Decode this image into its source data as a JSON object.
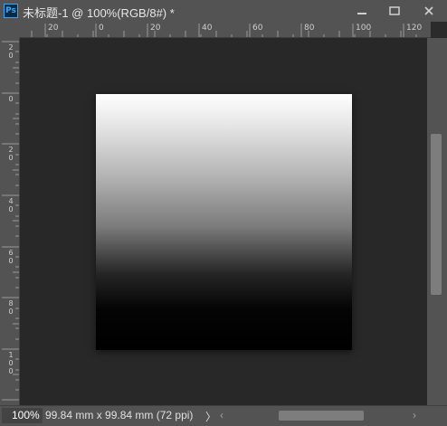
{
  "window": {
    "app_icon": "ps-app-icon",
    "app_icon_label": "Ps",
    "title": "未标题-1 @ 100%(RGB/8#) *"
  },
  "ruler_top": {
    "labels": [
      "20",
      "0",
      "20",
      "40",
      "60",
      "80",
      "100",
      "120"
    ]
  },
  "ruler_left": {
    "labels": [
      [
        "2",
        "0"
      ],
      [
        "0"
      ],
      [
        "2",
        "0"
      ],
      [
        "4",
        "0"
      ],
      [
        "6",
        "0"
      ],
      [
        "8",
        "0"
      ],
      [
        "1",
        "0",
        "0"
      ]
    ]
  },
  "canvas": {
    "gradient_top": "#ffffff",
    "gradient_bottom": "#000000",
    "background": "#282828"
  },
  "status": {
    "zoom": "100%",
    "doc_info": "99.84 mm x 99.84 mm (72 ppi)",
    "arrow": "〉",
    "scroll_left": "‹",
    "scroll_right": "›"
  }
}
